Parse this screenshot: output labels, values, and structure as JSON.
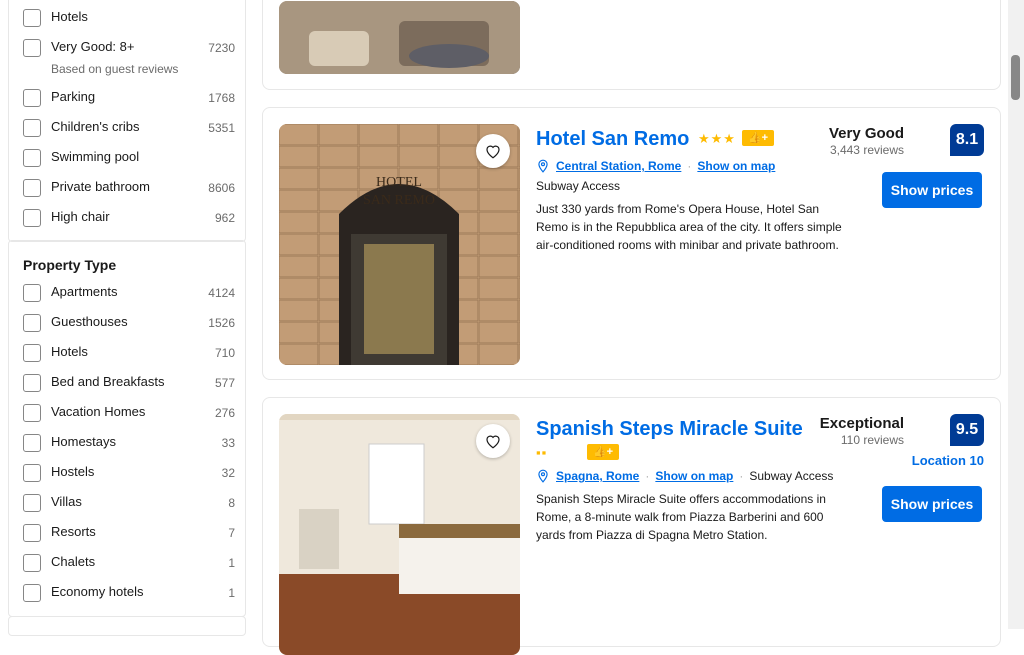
{
  "sidebar": {
    "facilities": [
      {
        "label": "Hotels",
        "count": ""
      },
      {
        "label": "Very Good: 8+",
        "count": "7230"
      },
      {
        "label": "Parking",
        "count": "1768"
      },
      {
        "label": "Children's cribs",
        "count": "5351"
      },
      {
        "label": "Swimming pool",
        "count": ""
      },
      {
        "label": "Private bathroom",
        "count": "8606"
      },
      {
        "label": "High chair",
        "count": "962"
      }
    ],
    "facilities_sub": "Based on guest reviews",
    "property_type_title": "Property Type",
    "property_types": [
      {
        "label": "Apartments",
        "count": "4124"
      },
      {
        "label": "Guesthouses",
        "count": "1526"
      },
      {
        "label": "Hotels",
        "count": "710"
      },
      {
        "label": "Bed and Breakfasts",
        "count": "577"
      },
      {
        "label": "Vacation Homes",
        "count": "276"
      },
      {
        "label": "Homestays",
        "count": "33"
      },
      {
        "label": "Hostels",
        "count": "32"
      },
      {
        "label": "Villas",
        "count": "8"
      },
      {
        "label": "Resorts",
        "count": "7"
      },
      {
        "label": "Chalets",
        "count": "1"
      },
      {
        "label": "Economy hotels",
        "count": "1"
      }
    ]
  },
  "results": [
    {
      "name": "Hotel San Remo",
      "stars": "★★★",
      "genius": "👍+",
      "location": "Central Station, Rome",
      "map": "Show on map",
      "transit": "Subway Access",
      "description": "Just 330 yards from Rome's Opera House, Hotel San Remo is in the Repubblica area of the city. It offers simple air-conditioned rooms with minibar and private bathroom.",
      "rating_word": "Very Good",
      "review_count": "3,443 reviews",
      "score": "8.1",
      "cta": "Show prices"
    },
    {
      "name": "Spanish Steps Miracle Suite",
      "stars": "▪▪",
      "genius": "👍+",
      "location": "Spagna, Rome",
      "map": "Show on map",
      "transit": "Subway Access",
      "description": "Spanish Steps Miracle Suite offers accommodations in Rome, a 8-minute walk from Piazza Barberini and 600 yards from Piazza di Spagna Metro Station.",
      "rating_word": "Exceptional",
      "review_count": "110 reviews",
      "score": "9.5",
      "location_score": "Location 10",
      "cta": "Show prices"
    }
  ],
  "colors": {
    "accent": "#006ce4",
    "score_bg": "#003b95",
    "star": "#febb02"
  }
}
